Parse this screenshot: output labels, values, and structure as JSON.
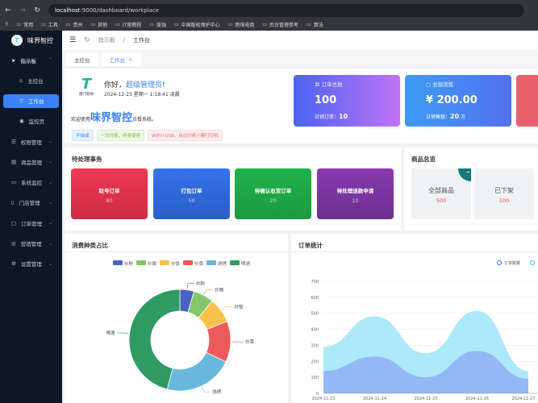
{
  "browser": {
    "url_host": "localhost",
    "url_path": ":9000/dashboard/workplace",
    "bookmarks": [
      "常用",
      "工具",
      "贵州",
      "其他",
      "IT营教程",
      "废蚀",
      "中国版权保护中心",
      "跨境电商",
      "后台管理参考",
      "算法"
    ]
  },
  "sidebar": {
    "brand": "味界智控",
    "items": [
      {
        "label": "指示板",
        "expanded": true
      },
      {
        "label": "主控台",
        "sub": true
      },
      {
        "label": "工作台",
        "sub": true,
        "active": true
      },
      {
        "label": "监控页",
        "sub": true
      },
      {
        "label": "权限管理"
      },
      {
        "label": "商品管理"
      },
      {
        "label": "系统监控"
      },
      {
        "label": "门店管理"
      },
      {
        "label": "订单管理"
      },
      {
        "label": "营销管理"
      },
      {
        "label": "设置管理"
      }
    ]
  },
  "header": {
    "breadcrumb": [
      "指示板",
      "工作台"
    ]
  },
  "tabs": [
    {
      "label": "主控台"
    },
    {
      "label": "工作台",
      "active": true,
      "close": "×"
    }
  ],
  "welcome": {
    "logo_text": "唐门智研",
    "greet": "你好，",
    "user": "超级管理员",
    "excl": "!",
    "datetime": "2024-12-23 星期一 1:18:41 凌晨",
    "pre": "欢迎使用",
    "brand": "味界智控",
    "post": "点餐系统。",
    "tags": [
      "不抽成",
      "一次付费，终身使用",
      "WIFI+USB，自动切纸小票打印机"
    ]
  },
  "stats": [
    {
      "title": "订单总数",
      "value": "100",
      "sub_label": "日销订单：",
      "sub_value": "10",
      "sub_unit": ""
    },
    {
      "title": "总额销售",
      "value": "¥ 200.00",
      "sub_label": "日销售额：",
      "sub_value": "20",
      "sub_unit": "万"
    }
  ],
  "pending": {
    "title": "待处理事务",
    "items": [
      {
        "label": "取号订单",
        "count": "80"
      },
      {
        "label": "打包订单",
        "count": "50"
      },
      {
        "label": "待确认收货订单",
        "count": "20"
      },
      {
        "label": "待处理退款申请",
        "count": "10"
      }
    ]
  },
  "goods": {
    "title": "商品总览",
    "items": [
      {
        "label": "全部商品",
        "count": "500"
      },
      {
        "label": "已下架",
        "count": "100"
      }
    ]
  },
  "chart_data": [
    {
      "type": "pie",
      "title": "消费种类占比",
      "categories": [
        "炒粉",
        "炒面",
        "炒饭",
        "炒菜",
        "烧烤",
        "啤酒"
      ],
      "values": [
        4.5,
        6.5,
        8,
        13,
        22,
        46
      ],
      "colors": [
        "#4a62c4",
        "#86c66a",
        "#f8c24a",
        "#ec5b5b",
        "#69b8dc",
        "#2f9a62"
      ],
      "legend": "top"
    },
    {
      "type": "area",
      "title": "订单统计",
      "x": [
        "2024-11-23",
        "2024-11-24",
        "2024-11-25",
        "2024-11-26",
        "2024-11-27"
      ],
      "ylim": [
        0,
        700
      ],
      "yticks": [
        0,
        100,
        200,
        300,
        400,
        500,
        600,
        700
      ],
      "series": [
        {
          "name": "订单数量",
          "values": [
            140,
            230,
            100,
            265,
            90
          ],
          "color": "#94b8f5"
        },
        {
          "name": "",
          "values": [
            290,
            480,
            250,
            515,
            140
          ],
          "color": "#a6e8fb"
        }
      ],
      "legend": "top-right",
      "grid": true
    }
  ]
}
